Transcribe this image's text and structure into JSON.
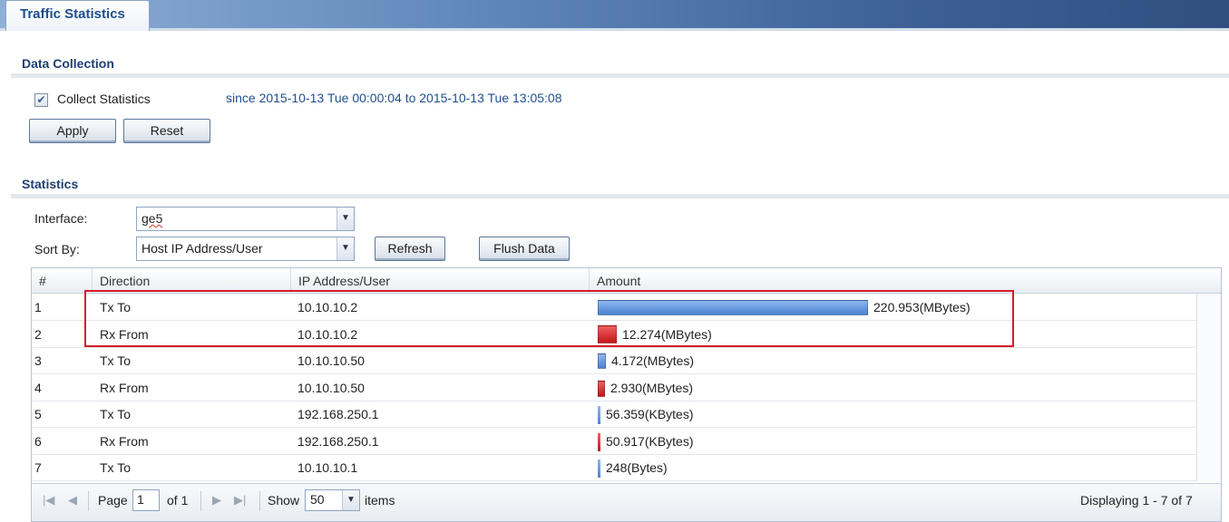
{
  "tab": {
    "title": "Traffic Statistics"
  },
  "data_collection": {
    "title": "Data Collection",
    "collect_label": "Collect Statistics",
    "collect_checked": true,
    "since_text": "since 2015-10-13 Tue 00:00:04 to 2015-10-13 Tue 13:05:08",
    "apply_label": "Apply",
    "reset_label": "Reset"
  },
  "statistics": {
    "title": "Statistics",
    "interface_label": "Interface:",
    "interface_value": "ge5",
    "sort_label": "Sort By:",
    "sort_value": "Host IP Address/User",
    "refresh_label": "Refresh",
    "flush_label": "Flush Data"
  },
  "table": {
    "headers": [
      "#",
      "Direction",
      "IP Address/User",
      "Amount"
    ],
    "rows": [
      {
        "num": "1",
        "direction": "Tx To",
        "ip": "10.10.10.2",
        "amount": "220.953(MBytes)",
        "kind": "tx",
        "bar_fraction": 1.0
      },
      {
        "num": "2",
        "direction": "Rx From",
        "ip": "10.10.10.2",
        "amount": "12.274(MBytes)",
        "kind": "rx",
        "bar_fraction": 0.07
      },
      {
        "num": "3",
        "direction": "Tx To",
        "ip": "10.10.10.50",
        "amount": "4.172(MBytes)",
        "kind": "tx",
        "bar_fraction": 0.03
      },
      {
        "num": "4",
        "direction": "Rx From",
        "ip": "10.10.10.50",
        "amount": "2.930(MBytes)",
        "kind": "rx",
        "bar_fraction": 0.02
      },
      {
        "num": "5",
        "direction": "Tx To",
        "ip": "192.168.250.1",
        "amount": "56.359(KBytes)",
        "kind": "tx",
        "bar_fraction": 0.0
      },
      {
        "num": "6",
        "direction": "Rx From",
        "ip": "192.168.250.1",
        "amount": "50.917(KBytes)",
        "kind": "rx",
        "bar_fraction": 0.0
      },
      {
        "num": "7",
        "direction": "Tx To",
        "ip": "10.10.10.1",
        "amount": "248(Bytes)",
        "kind": "tx",
        "bar_fraction": 0.0
      }
    ]
  },
  "pager": {
    "page_label": "Page",
    "page_value": "1",
    "of_label": "of 1",
    "show_label": "Show",
    "show_value": "50",
    "items_label": "items",
    "displaying": "Displaying 1 - 7 of 7"
  },
  "colors": {
    "tx_bar": "#4a82d4",
    "rx_bar": "#c21818",
    "highlight": "#d41c2c",
    "title": "#1e3f73"
  }
}
